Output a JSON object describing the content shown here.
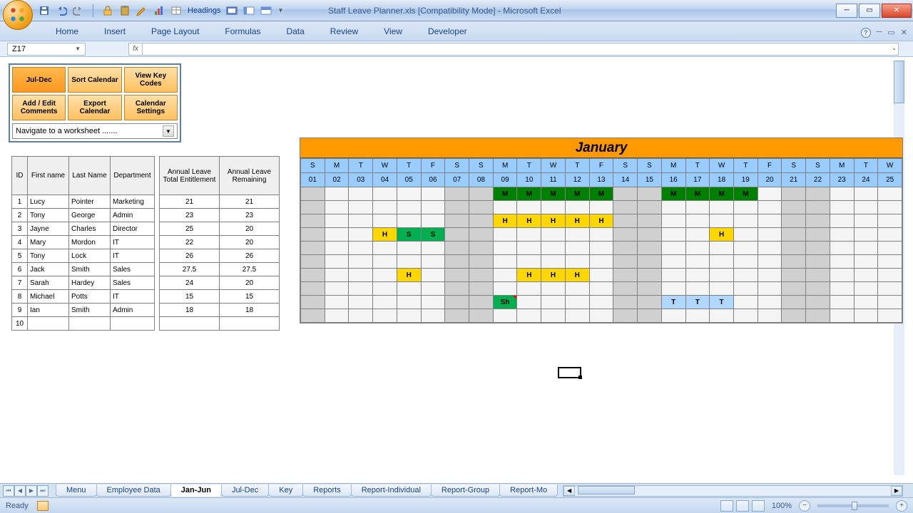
{
  "window": {
    "title": "Staff Leave Planner.xls  [Compatibility Mode] - Microsoft Excel"
  },
  "qat": {
    "headings_label": "Headings"
  },
  "ribbon": {
    "tabs": [
      "Home",
      "Insert",
      "Page Layout",
      "Formulas",
      "Data",
      "Review",
      "View",
      "Developer"
    ]
  },
  "name_box": "Z17",
  "toolbox": {
    "btns": [
      {
        "label": "Jul-Dec"
      },
      {
        "label": "Sort Calendar"
      },
      {
        "label": "View Key Codes"
      },
      {
        "label": "Add / Edit Comments"
      },
      {
        "label": "Export Calendar"
      },
      {
        "label": "Calendar Settings"
      }
    ],
    "nav_placeholder": "Navigate to a worksheet ......."
  },
  "staff_headers": {
    "id": "ID",
    "first": "First name",
    "last": "Last Name",
    "dep": "Department"
  },
  "leave_headers": {
    "ent": "Annual Leave Total Entitlement",
    "rem": "Annual Leave Remaining"
  },
  "staff": [
    {
      "id": "1",
      "first": "Lucy",
      "last": "Pointer",
      "dep": "Marketing",
      "ent": "21",
      "rem": "21"
    },
    {
      "id": "2",
      "first": "Tony",
      "last": "George",
      "dep": "Admin",
      "ent": "23",
      "rem": "23"
    },
    {
      "id": "3",
      "first": "Jayne",
      "last": "Charles",
      "dep": "Director",
      "ent": "25",
      "rem": "20"
    },
    {
      "id": "4",
      "first": "Mary",
      "last": "Mordon",
      "dep": "IT",
      "ent": "22",
      "rem": "20"
    },
    {
      "id": "5",
      "first": "Tony",
      "last": "Lock",
      "dep": "IT",
      "ent": "26",
      "rem": "26"
    },
    {
      "id": "6",
      "first": "Jack",
      "last": "Smith",
      "dep": "Sales",
      "ent": "27.5",
      "rem": "27.5"
    },
    {
      "id": "7",
      "first": "Sarah",
      "last": "Hardey",
      "dep": "Sales",
      "ent": "24",
      "rem": "20"
    },
    {
      "id": "8",
      "first": "Michael",
      "last": "Potts",
      "dep": "IT",
      "ent": "15",
      "rem": "15"
    },
    {
      "id": "9",
      "first": "Ian",
      "last": "Smith",
      "dep": "Admin",
      "ent": "18",
      "rem": "18"
    },
    {
      "id": "10",
      "first": "",
      "last": "",
      "dep": "",
      "ent": "",
      "rem": ""
    }
  ],
  "month": "January",
  "days": [
    "S",
    "M",
    "T",
    "W",
    "T",
    "F",
    "S",
    "S",
    "M",
    "T",
    "W",
    "T",
    "F",
    "S",
    "S",
    "M",
    "T",
    "W",
    "T",
    "F",
    "S",
    "S",
    "M",
    "T",
    "W"
  ],
  "dates": [
    "01",
    "02",
    "03",
    "04",
    "05",
    "06",
    "07",
    "08",
    "09",
    "10",
    "11",
    "12",
    "13",
    "14",
    "15",
    "16",
    "17",
    "18",
    "19",
    "20",
    "21",
    "22",
    "23",
    "24",
    "25"
  ],
  "weekend_cols": [
    0,
    6,
    7,
    13,
    14,
    20,
    21
  ],
  "entries": {
    "0": {
      "8": "M",
      "9": "M",
      "10": "M",
      "11": "M",
      "12": "M",
      "15": "M",
      "16": "M",
      "17": "M",
      "18": "M"
    },
    "2": {
      "8": "H",
      "9": "H",
      "10": "H",
      "11": "H",
      "12": "H"
    },
    "3": {
      "3": "H",
      "4": "S",
      "5": "S",
      "17": "H"
    },
    "6": {
      "4": "H",
      "9": "H",
      "10": "H",
      "11": "H"
    },
    "8": {
      "8": "Sh",
      "15": "T",
      "16": "T",
      "17": "T"
    }
  },
  "sheet_tabs": [
    "Menu",
    "Employee Data",
    "Jan-Jun",
    "Jul-Dec",
    "Key",
    "Reports",
    "Report-Individual",
    "Report-Group",
    "Report-Mo"
  ],
  "active_sheet": 2,
  "status": {
    "ready": "Ready",
    "zoom": "100%"
  }
}
